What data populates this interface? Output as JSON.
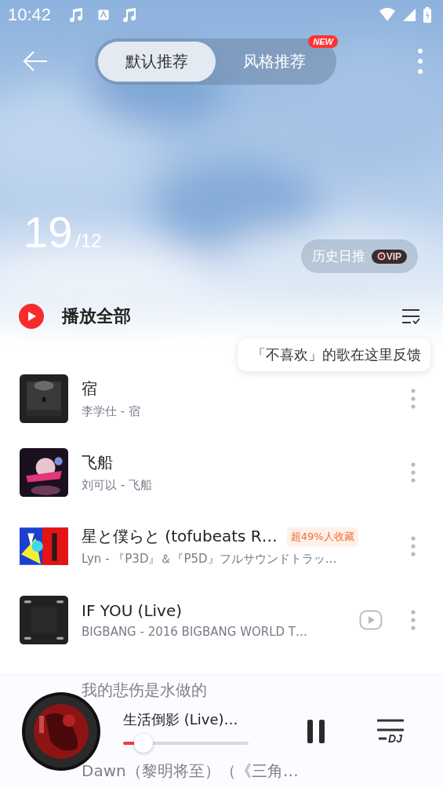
{
  "status_bar": {
    "time": "10:42"
  },
  "tabs": [
    {
      "label": "默认推荐",
      "selected": true
    },
    {
      "label": "风格推荐",
      "selected": false,
      "badge": "NEW"
    }
  ],
  "date": {
    "day": "19",
    "month": "/12"
  },
  "history_button": {
    "label": "历史日推",
    "badge": "VIP"
  },
  "play_all": {
    "label": "播放全部"
  },
  "tooltip": "「不喜欢」的歌在这里反馈",
  "songs": [
    {
      "title": "宿",
      "subtitle": "李学仕 - 宿",
      "mv": false
    },
    {
      "title": "飞船",
      "subtitle": "刘可以 - 飞船",
      "mv": false
    },
    {
      "title": "星と僕らと (tofubeats R…",
      "subtitle": "Lyn - 『P3D』＆『P5D』フルサウンドトラッ…",
      "tag": "超49%人收藏",
      "mv": false
    },
    {
      "title": "IF YOU (Live)",
      "subtitle": "BIGBANG - 2016 BIGBANG WORLD T…",
      "mv": true
    }
  ],
  "hidden_songs": [
    {
      "title": "我的悲伤是水做的"
    },
    {
      "title": "Dawn（黎明将至）（《三角…"
    }
  ],
  "player": {
    "title": "生活倒影 (Live)…",
    "level": 0.1,
    "playlist_label": "DJ"
  }
}
